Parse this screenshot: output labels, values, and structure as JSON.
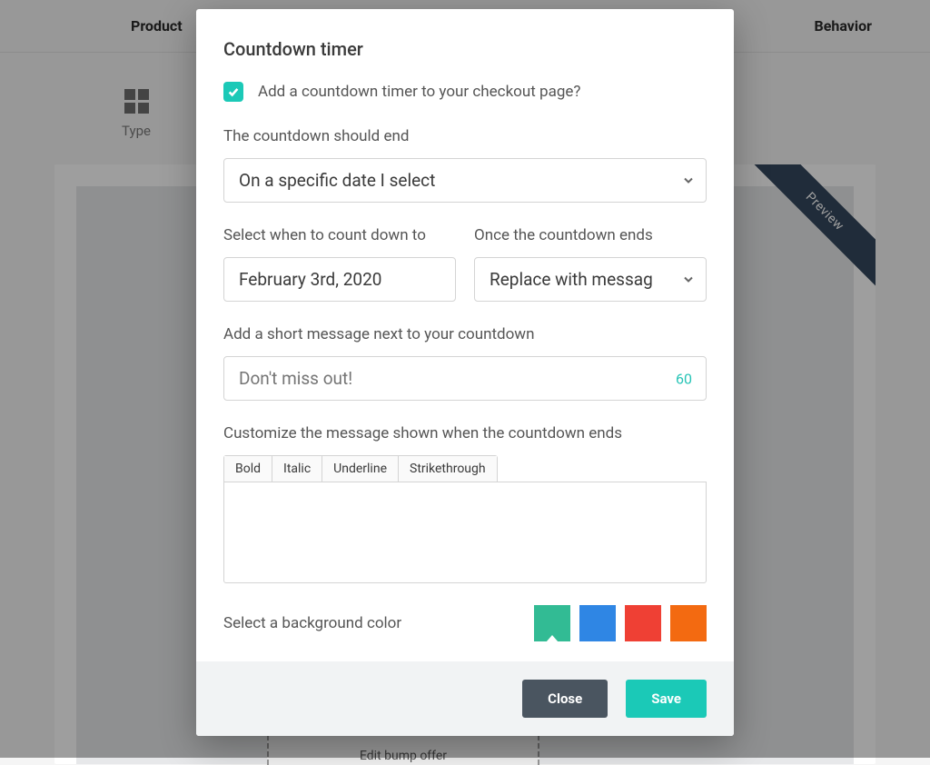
{
  "bg": {
    "header": {
      "product": "Product",
      "behavior": "Behavior"
    },
    "sidebar": {
      "type_label": "Type"
    },
    "preview_ribbon": "Preview",
    "bump_label": "Edit bump offer"
  },
  "modal": {
    "title": "Countdown timer",
    "checkbox_label": "Add a countdown timer to your checkout page?",
    "checkbox_checked": true,
    "end_label": "The countdown should end",
    "end_select_value": "On a specific date I select",
    "date_label": "Select when to count down to",
    "date_value": "February 3rd, 2020",
    "after_label": "Once the countdown ends",
    "after_value": "Replace with messag",
    "message_label": "Add a short message next to your countdown",
    "message_placeholder": "Don't miss out!",
    "message_counter": "60",
    "customize_label": "Customize the message shown when the countdown ends",
    "toolbar": {
      "bold": "Bold",
      "italic": "Italic",
      "underline": "Underline",
      "strike": "Strikethrough"
    },
    "color_label": "Select a background color",
    "colors": {
      "teal": "#32bb94",
      "blue": "#2f86e4",
      "red": "#ef4034",
      "orange": "#f36a11"
    },
    "footer": {
      "close": "Close",
      "save": "Save"
    }
  }
}
